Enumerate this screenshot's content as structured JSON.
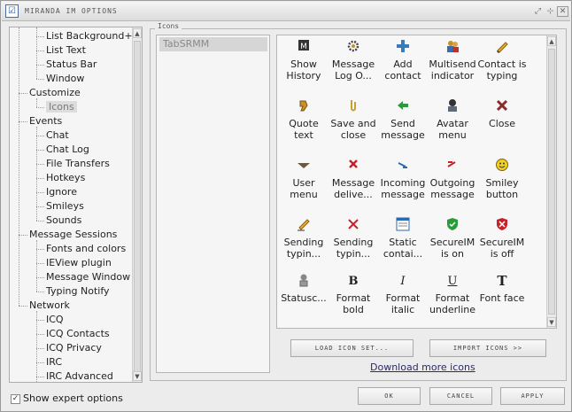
{
  "window": {
    "title": "MIRANDA IM OPTIONS",
    "app_icon": "checklist-icon",
    "buttons": [
      "restore-icon",
      "minimize-icon",
      "close-icon"
    ]
  },
  "tree": {
    "items": [
      {
        "label": "List Background+",
        "level": 1
      },
      {
        "label": "List Text",
        "level": 1
      },
      {
        "label": "Status Bar",
        "level": 1
      },
      {
        "label": "Window",
        "level": 1
      },
      {
        "label": "Customize",
        "level": 0
      },
      {
        "label": "Icons",
        "level": 1,
        "selected": true
      },
      {
        "label": "Events",
        "level": 0
      },
      {
        "label": "Chat",
        "level": 1
      },
      {
        "label": "Chat Log",
        "level": 1
      },
      {
        "label": "File Transfers",
        "level": 1
      },
      {
        "label": "Hotkeys",
        "level": 1
      },
      {
        "label": "Ignore",
        "level": 1
      },
      {
        "label": "Smileys",
        "level": 1
      },
      {
        "label": "Sounds",
        "level": 1
      },
      {
        "label": "Message Sessions",
        "level": 0
      },
      {
        "label": "Fonts and colors",
        "level": 1
      },
      {
        "label": "IEView plugin",
        "level": 1
      },
      {
        "label": "Message Window",
        "level": 1
      },
      {
        "label": "Typing Notify",
        "level": 1
      },
      {
        "label": "Network",
        "level": 0
      },
      {
        "label": "ICQ",
        "level": 1
      },
      {
        "label": "ICQ Contacts",
        "level": 1
      },
      {
        "label": "ICQ Privacy",
        "level": 1
      },
      {
        "label": "IRC",
        "level": 1
      },
      {
        "label": "IRC Advanced",
        "level": 1
      }
    ]
  },
  "expert": {
    "label": "Show expert options",
    "checked": true
  },
  "group": {
    "legend": "Icons",
    "categories": [
      "TabSRMM"
    ]
  },
  "icons": [
    {
      "label": "Show\nHistory",
      "icon": "history-icon"
    },
    {
      "label": "Message\nLog O...",
      "icon": "gear-icon"
    },
    {
      "label": "Add\ncontact",
      "icon": "plus-icon"
    },
    {
      "label": "Multisend\nindicator",
      "icon": "multi-user-icon"
    },
    {
      "label": "Contact is\ntyping",
      "icon": "pencil-icon"
    },
    {
      "label": "Quote\ntext",
      "icon": "quote-icon"
    },
    {
      "label": "Save and\nclose",
      "icon": "paperclip-icon"
    },
    {
      "label": "Send\nmessage",
      "icon": "send-arrow-icon"
    },
    {
      "label": "Avatar\nmenu",
      "icon": "avatar-icon"
    },
    {
      "label": "Close",
      "icon": "close-x-icon"
    },
    {
      "label": "User menu",
      "icon": "user-menu-icon"
    },
    {
      "label": "Message\ndelive...",
      "icon": "red-x-icon"
    },
    {
      "label": "Incoming\nmessage",
      "icon": "incoming-icon"
    },
    {
      "label": "Outgoing\nmessage",
      "icon": "outgoing-icon"
    },
    {
      "label": "Smiley\nbutton",
      "icon": "smiley-icon"
    },
    {
      "label": "Sending\ntypin...",
      "icon": "pencil-send-icon"
    },
    {
      "label": "Sending\ntypin...",
      "icon": "red-x-typing-icon"
    },
    {
      "label": "Static\ncontai...",
      "icon": "container-icon"
    },
    {
      "label": "SecureIM\nis on",
      "icon": "shield-on-icon"
    },
    {
      "label": "SecureIM\nis off",
      "icon": "shield-off-icon"
    },
    {
      "label": "Statusc...",
      "icon": "status-icon"
    },
    {
      "label": "Format\nbold",
      "icon": "bold-icon"
    },
    {
      "label": "Format\nitalic",
      "icon": "italic-icon"
    },
    {
      "label": "Format\nunderline",
      "icon": "underline-icon"
    },
    {
      "label": "Font face",
      "icon": "font-face-icon"
    }
  ],
  "buttons": {
    "load": "LOAD ICON SET...",
    "import": "IMPORT ICONS >>",
    "download": "Download more icons",
    "ok": "OK",
    "cancel": "CANCEL",
    "apply": "APPLY"
  },
  "colors": {
    "accent_red": "#c8202a",
    "accent_green": "#2a9a3a",
    "accent_blue": "#2a6ab0"
  }
}
